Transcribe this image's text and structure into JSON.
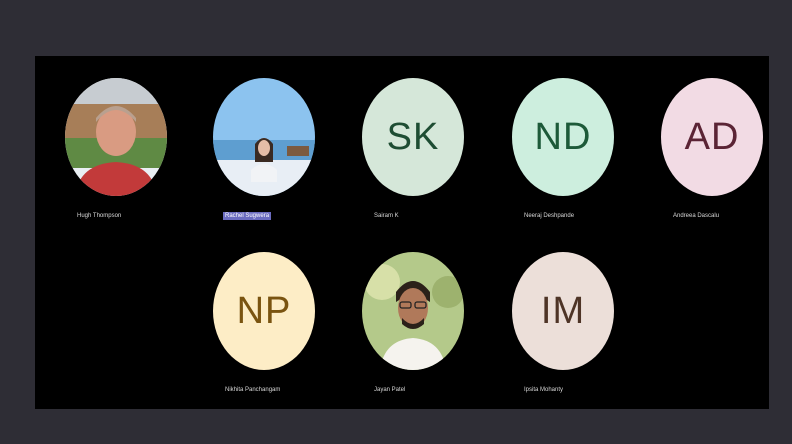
{
  "participants": [
    {
      "name": "Hugh Thompson",
      "type": "photo",
      "icon": "person-photo-icon"
    },
    {
      "name": "Rachel Sugwera",
      "type": "photo",
      "icon": "person-photo-icon",
      "speaking": true
    },
    {
      "name": "Sairam K",
      "initials": "SK",
      "bg": "#d5e7d9",
      "fg": "#1e4d33"
    },
    {
      "name": "Neeraj Deshpande",
      "initials": "ND",
      "bg": "#cdeede",
      "fg": "#1d5a39"
    },
    {
      "name": "Andreea Dascalu",
      "initials": "AD",
      "bg": "#f2dbe4",
      "fg": "#5b2435"
    },
    {
      "name": "Nikhita Panchangam",
      "initials": "NP",
      "bg": "#fdedc6",
      "fg": "#7a5410"
    },
    {
      "name": "Jayan Patel",
      "type": "photo",
      "icon": "person-photo-icon"
    },
    {
      "name": "Ipsita Mohanty",
      "initials": "IM",
      "bg": "#ecdfd9",
      "fg": "#4e3426"
    }
  ]
}
